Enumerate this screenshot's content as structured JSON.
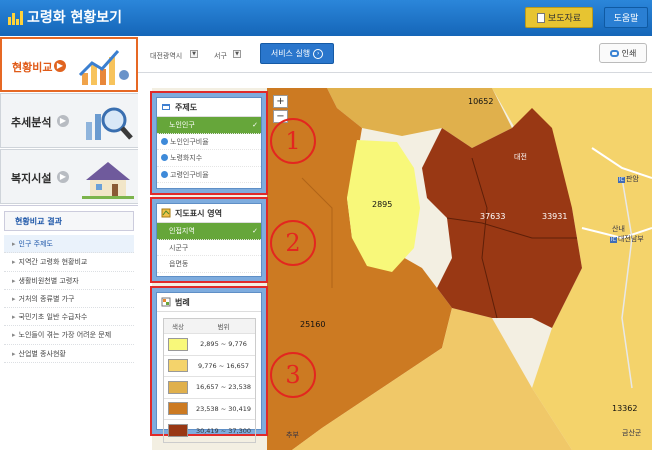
{
  "header": {
    "title": "고령화 현황보기",
    "press_label": "보도자료",
    "help_label": "도움말"
  },
  "nav": [
    {
      "label": "현황비교",
      "active": true
    },
    {
      "label": "추세분석",
      "active": false
    },
    {
      "label": "복지시설",
      "active": false
    }
  ],
  "results": {
    "title": "현황비교 결과",
    "items": [
      "인구 주제도",
      "지역간 고령화 현황비교",
      "생활비원천별 고령자",
      "거처의 종류별 가구",
      "국민기초 일반 수급자수",
      "노인들이 겪는 가장 어려운 문제",
      "산업별 종사현황"
    ]
  },
  "toolbar": {
    "region1": "대전광역시",
    "region2": "서구",
    "run_label": "서비스 실행",
    "print_label": "인쇄"
  },
  "map": {
    "zoom_in": "+",
    "zoom_out": "−",
    "values": {
      "v_top": "10652",
      "v_yellow": "2895",
      "v_east1": "37633",
      "v_east2": "33931",
      "v_west": "25160",
      "v_se": "13362"
    },
    "places": [
      "대전",
      "산내",
      "판암",
      "대전남부",
      "금산군",
      "추부"
    ],
    "ic_label": "IC"
  },
  "theme_panel": {
    "title": "주제도",
    "items": [
      {
        "label": "노인인구",
        "selected": true
      },
      {
        "label": "노인인구비율",
        "selected": false
      },
      {
        "label": "노령화지수",
        "selected": false
      },
      {
        "label": "고령인구비율",
        "selected": false
      }
    ]
  },
  "area_panel": {
    "title": "지도표시 영역",
    "items": [
      {
        "label": "인접지역",
        "selected": true
      },
      {
        "label": "시군구",
        "selected": false
      },
      {
        "label": "읍면동",
        "selected": false
      }
    ]
  },
  "legend_panel": {
    "title": "범례",
    "col_color": "색상",
    "col_range": "범위",
    "rows": [
      {
        "color": "#f8f87a",
        "range": "2,895 ~ 9,776"
      },
      {
        "color": "#f4d36b",
        "range": "9,776 ~ 16,657"
      },
      {
        "color": "#e0b04c",
        "range": "16,657 ~ 23,538"
      },
      {
        "color": "#cc7a22",
        "range": "23,538 ~ 30,419"
      },
      {
        "color": "#993814",
        "range": "30,419 ~ 37,300"
      }
    ]
  },
  "annotations": [
    "1",
    "2",
    "3"
  ],
  "colors": {
    "header": "#1b73c9",
    "accent": "#e66824",
    "panel_border": "#e02a2a"
  }
}
